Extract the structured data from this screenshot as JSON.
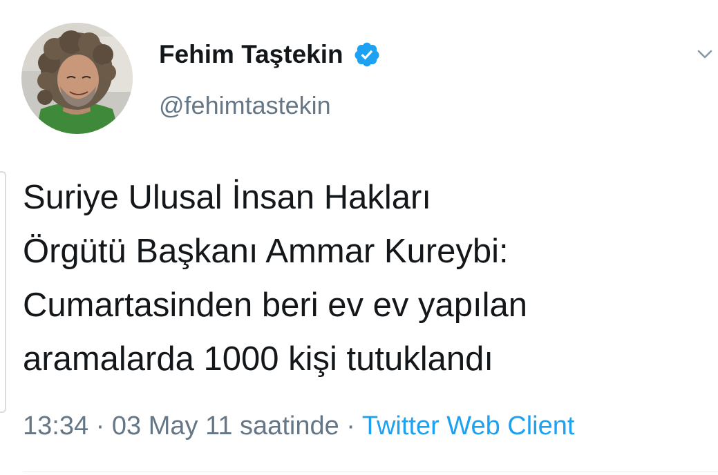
{
  "author": {
    "name": "Fehim Taştekin",
    "handle": "@fehimtastekin",
    "verified_icon": "verified-badge-icon",
    "avatar_icon": "profile-photo"
  },
  "menu": {
    "icon": "chevron-down-icon"
  },
  "tweet": {
    "lines": [
      "Suriye Ulusal İnsan Hakları",
      "Örgütü Başkanı Ammar Kureybi:",
      "Cumartasinden beri ev ev yapılan",
      "aramalarda 1000 kişi tutuklandı"
    ]
  },
  "meta": {
    "time": "13:34",
    "sep1": " · ",
    "date": "03 May 11 saatinde",
    "sep2": " · ",
    "source": "Twitter Web Client"
  },
  "colors": {
    "text": "#14171a",
    "secondary": "#657786",
    "link": "#1da1f2",
    "verified": "#1da1f2"
  }
}
